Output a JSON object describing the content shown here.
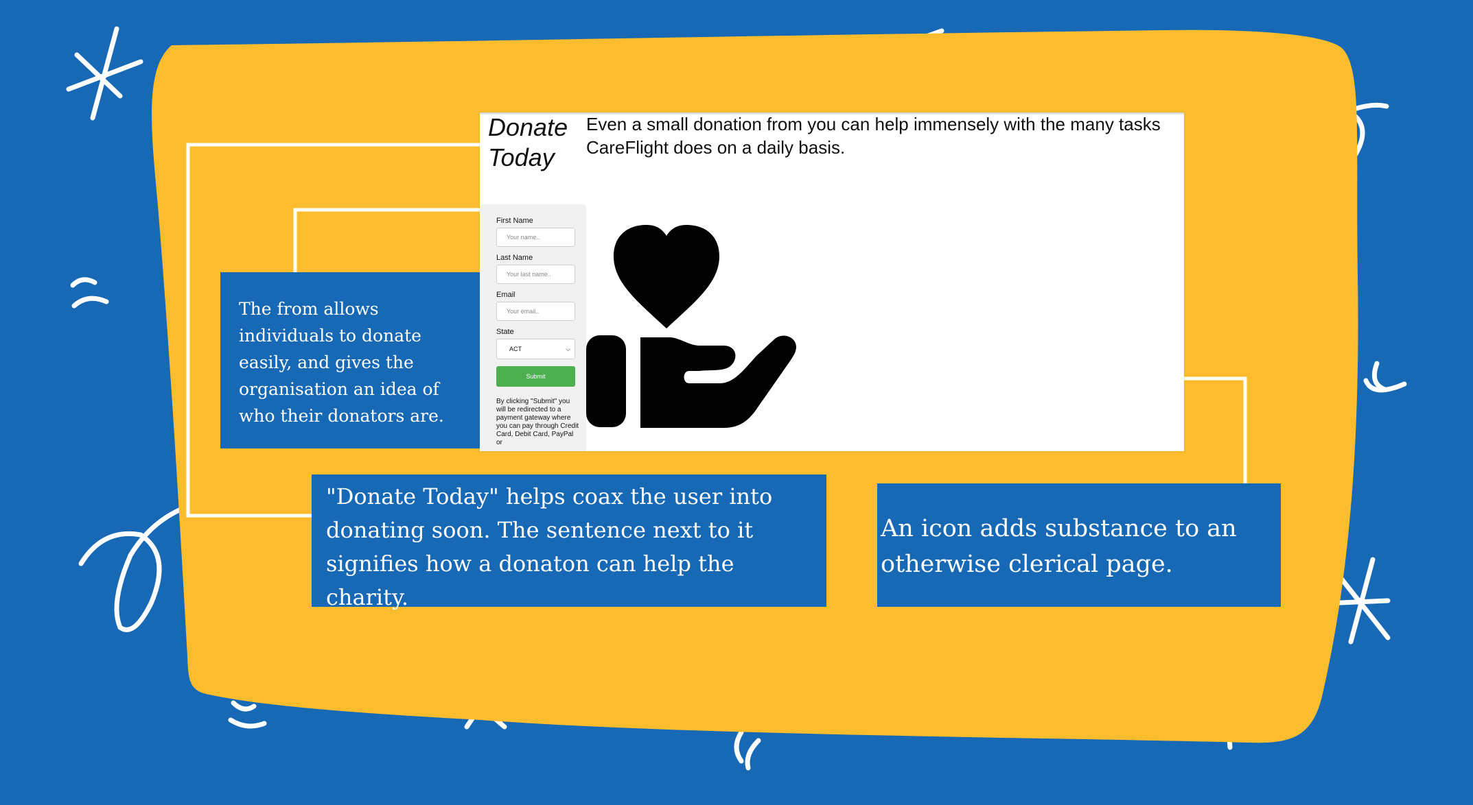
{
  "colors": {
    "background": "#1769b5",
    "panel": "#fbbd2e",
    "callout": "#1769b5",
    "submit": "#4caf50"
  },
  "screenshot": {
    "title": "Donate Today",
    "sentence": "Even a small donation from you can help immensely with the many tasks CareFlight does on a daily basis.",
    "form": {
      "first_name_label": "First Name",
      "first_name_placeholder": "Your name..",
      "last_name_label": "Last Name",
      "last_name_placeholder": "Your last name..",
      "email_label": "Email",
      "email_placeholder": "Your email..",
      "state_label": "State",
      "state_value": "ACT",
      "submit_label": "Submit",
      "note": "By clicking \"Submit\" you will be redirected to a payment gateway where you can pay through Credit Card, Debit Card, PayPal or"
    },
    "icon": "heart-in-hand-icon"
  },
  "callouts": {
    "form": "The from allows individuals to donate easily, and gives the organisation an idea of who their donators are.",
    "title": "\"Donate Today\" helps coax the user into donating soon. The sentence next to it signifies how a donaton can help the charity.",
    "icon": "An icon adds substance to an otherwise clerical page."
  }
}
